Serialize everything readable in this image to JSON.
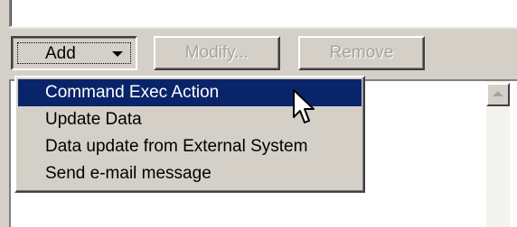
{
  "buttons": {
    "add_label": "Add",
    "modify_label": "Modify...",
    "remove_label": "Remove"
  },
  "menu": {
    "items": [
      {
        "label": "Command Exec Action",
        "selected": true
      },
      {
        "label": "Update Data",
        "selected": false
      },
      {
        "label": "Data update from External System",
        "selected": false
      },
      {
        "label": "Send e-mail message",
        "selected": false
      }
    ]
  },
  "icons": {
    "dropdown": "chevron-down-icon",
    "cursor": "mouse-pointer-icon",
    "scroll_up": "scroll-up-arrow-icon"
  },
  "colors": {
    "face": "#d4d0c8",
    "highlight": "#0a246a",
    "disabled_text": "#a6a39c"
  }
}
